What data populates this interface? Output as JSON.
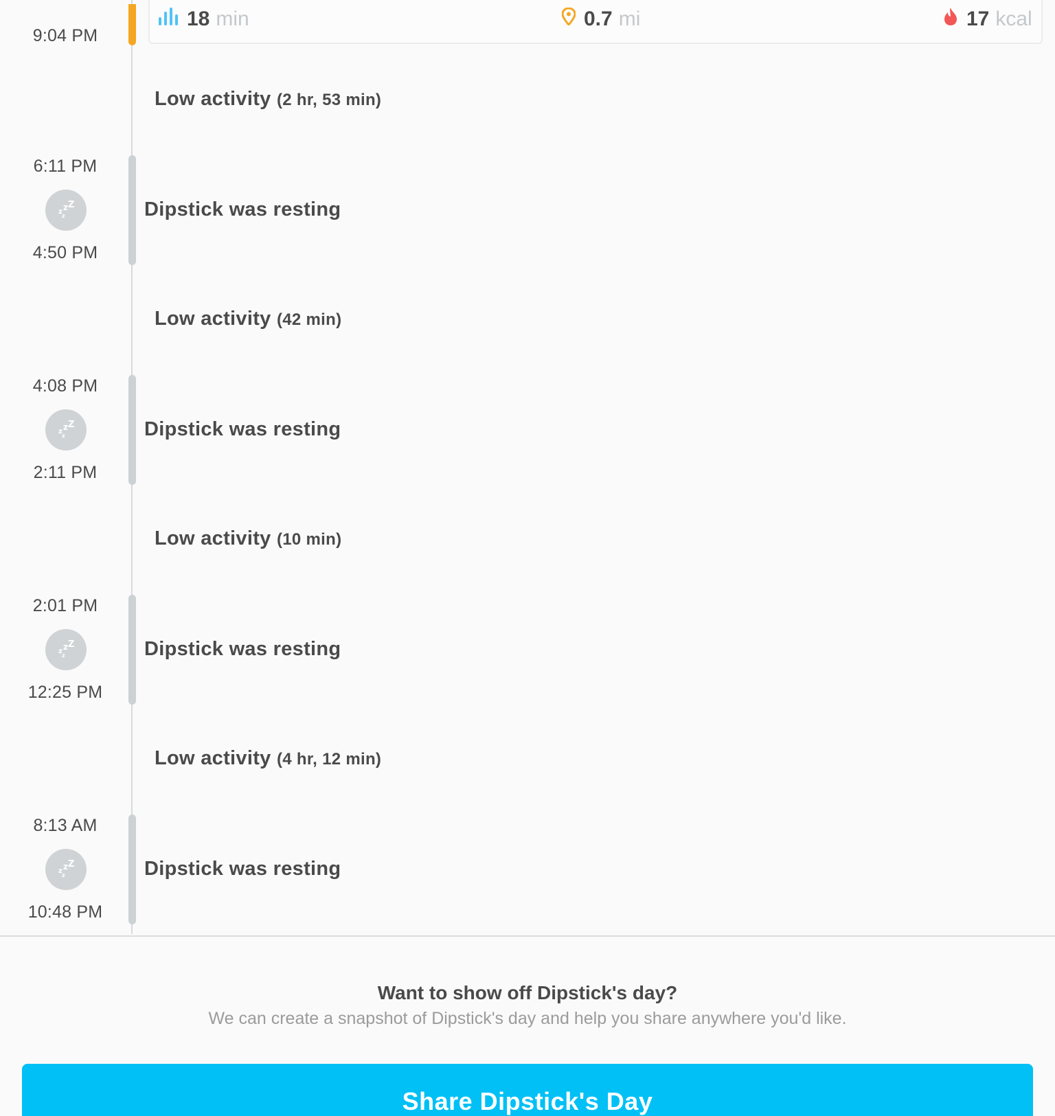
{
  "stats": {
    "active": {
      "value": "18",
      "unit": "min",
      "icon": "bar-chart-icon",
      "color": "#4fc3f7"
    },
    "distance": {
      "value": "0.7",
      "unit": "mi",
      "icon": "location-pin-icon",
      "color": "#f5a623"
    },
    "calories": {
      "value": "17",
      "unit": "kcal",
      "icon": "flame-icon",
      "color": "#f25757"
    }
  },
  "timeline": {
    "active_end_time": "9:04 PM",
    "low_1": {
      "label": "Low activity",
      "duration": "(2 hr, 53 min)"
    },
    "rest_1": {
      "start": "6:11 PM",
      "end": "4:50 PM",
      "label": "Dipstick was resting"
    },
    "low_2": {
      "label": "Low activity",
      "duration": "(42 min)"
    },
    "rest_2": {
      "start": "4:08 PM",
      "end": "2:11 PM",
      "label": "Dipstick was resting"
    },
    "low_3": {
      "label": "Low activity",
      "duration": "(10 min)"
    },
    "rest_3": {
      "start": "2:01 PM",
      "end": "12:25 PM",
      "label": "Dipstick was resting"
    },
    "low_4": {
      "label": "Low activity",
      "duration": "(4 hr, 12 min)"
    },
    "rest_4": {
      "start": "8:13 AM",
      "end": "10:48 PM",
      "label": "Dipstick was resting"
    }
  },
  "colors": {
    "active_bar": "#f5a623",
    "rest_bar": "#ccd1d4",
    "share_button": "#00c0f5"
  },
  "share": {
    "title": "Want to show off Dipstick's day?",
    "subtitle": "We can create a snapshot of Dipstick's day and help you share anywhere you'd like.",
    "button_label": "Share Dipstick's Day"
  }
}
